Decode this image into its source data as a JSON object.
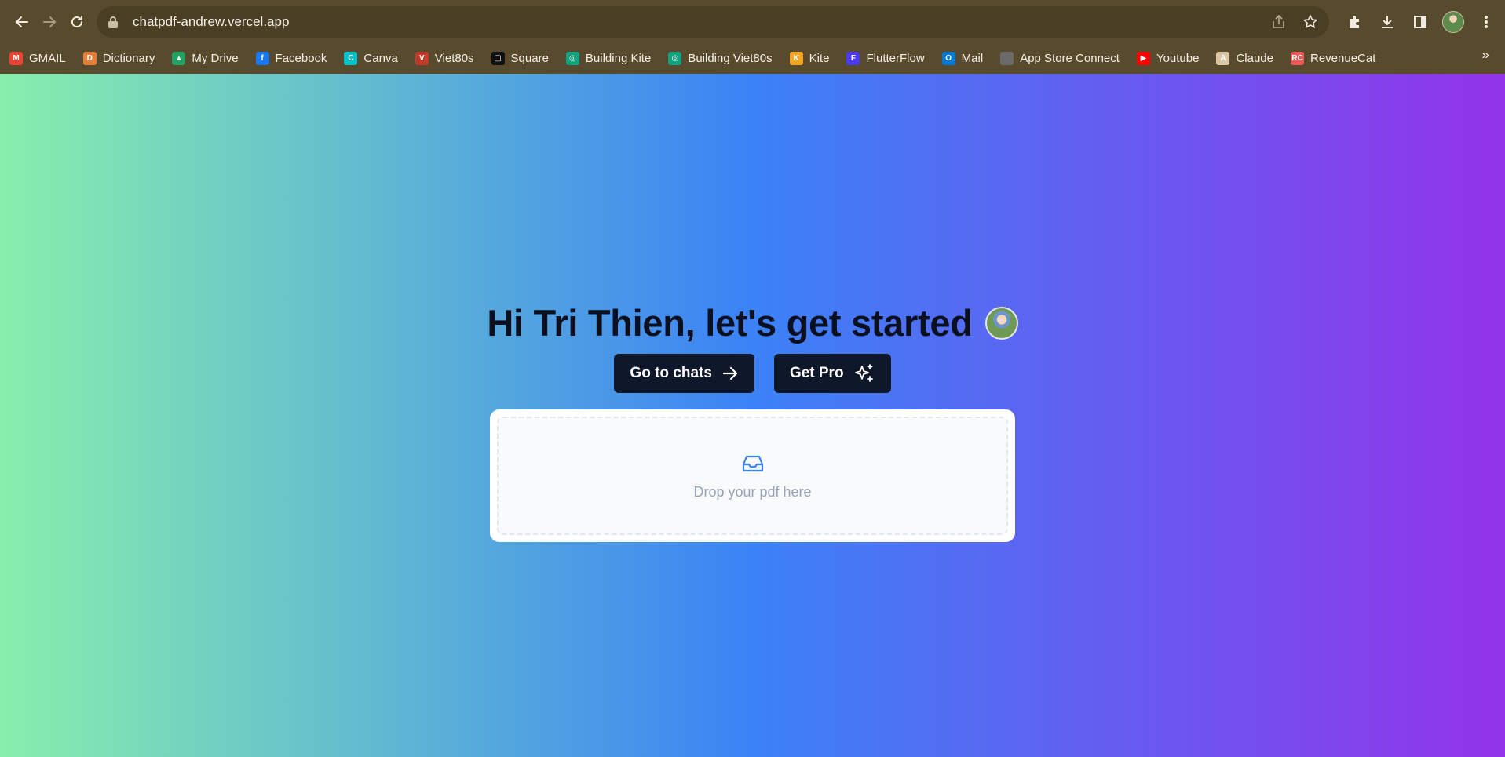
{
  "browser": {
    "url": "chatpdf-andrew.vercel.app",
    "bookmarks": [
      {
        "label": "GMAIL",
        "icon": "gmail-icon",
        "color": "#ea4335",
        "glyph": "M"
      },
      {
        "label": "Dictionary",
        "icon": "dictionary-icon",
        "color": "#e57f3a",
        "glyph": "D"
      },
      {
        "label": "My Drive",
        "icon": "drive-icon",
        "color": "#1fa463",
        "glyph": "▲"
      },
      {
        "label": "Facebook",
        "icon": "facebook-icon",
        "color": "#1877f2",
        "glyph": "f"
      },
      {
        "label": "Canva",
        "icon": "canva-icon",
        "color": "#00c4cc",
        "glyph": "C"
      },
      {
        "label": "Viet80s",
        "icon": "viet80s-icon",
        "color": "#c0392b",
        "glyph": "V"
      },
      {
        "label": "Square",
        "icon": "square-icon",
        "color": "#111111",
        "glyph": "▢"
      },
      {
        "label": "Building Kite",
        "icon": "openai-icon",
        "color": "#10a37f",
        "glyph": "◎"
      },
      {
        "label": "Building Viet80s",
        "icon": "openai-icon",
        "color": "#10a37f",
        "glyph": "◎"
      },
      {
        "label": "Kite",
        "icon": "kite-icon",
        "color": "#f5a623",
        "glyph": "K"
      },
      {
        "label": "FlutterFlow",
        "icon": "flutterflow-icon",
        "color": "#4b39ef",
        "glyph": "F"
      },
      {
        "label": "Mail",
        "icon": "outlook-icon",
        "color": "#0078d4",
        "glyph": "O"
      },
      {
        "label": "App Store Connect",
        "icon": "apple-icon",
        "color": "#6b6b6b",
        "glyph": ""
      },
      {
        "label": "Youtube",
        "icon": "youtube-icon",
        "color": "#ff0000",
        "glyph": "▶"
      },
      {
        "label": "Claude",
        "icon": "claude-icon",
        "color": "#d9c7a6",
        "glyph": "A"
      },
      {
        "label": "RevenueCat",
        "icon": "revenuecat-icon",
        "color": "#f25a5a",
        "glyph": "RC"
      }
    ],
    "more_label": "»"
  },
  "hero": {
    "title": "Hi Tri Thien, let's get started",
    "go_to_chats_label": "Go to chats",
    "get_pro_label": "Get Pro"
  },
  "dropzone": {
    "text": "Drop your pdf here"
  }
}
